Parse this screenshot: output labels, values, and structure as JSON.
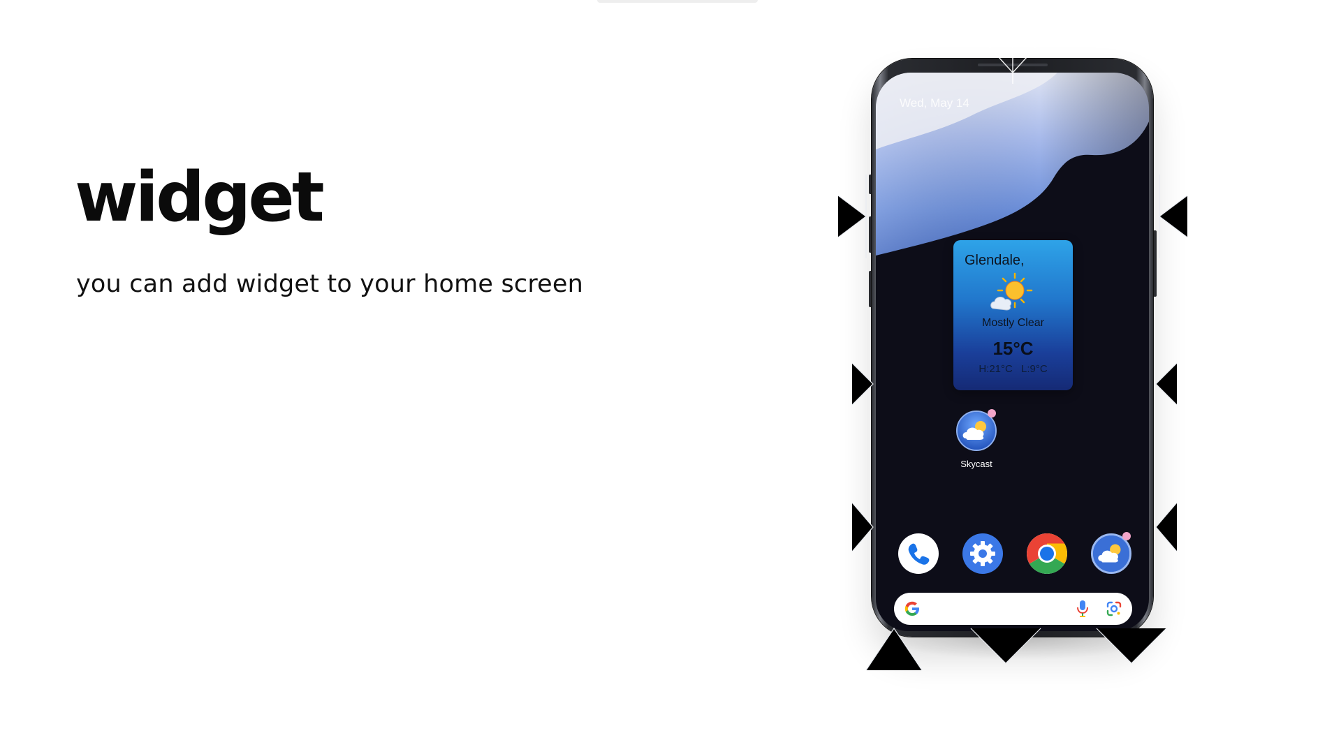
{
  "hero": {
    "title": "widget",
    "subtitle": "you can add widget to your home screen"
  },
  "phone": {
    "status_date": "Wed, May 14",
    "widget": {
      "city": "Glendale,",
      "condition": "Mostly Clear",
      "temperature": "15°C",
      "high_low": "H:21°C L:9°C",
      "icon": "sun-behind-cloud-icon"
    },
    "home_app": {
      "label": "Skycast",
      "icon": "skycast-weather-icon"
    },
    "dock": [
      {
        "name": "phone",
        "icon": "phone-icon"
      },
      {
        "name": "settings",
        "icon": "settings-gear-icon"
      },
      {
        "name": "chrome",
        "icon": "chrome-icon"
      },
      {
        "name": "skycast",
        "icon": "skycast-weather-icon"
      }
    ],
    "search_bar": {
      "icons": [
        "google-g-icon",
        "microphone-icon",
        "google-lens-icon"
      ]
    }
  },
  "colors": {
    "widget_top": "#2ea3e8",
    "widget_bottom": "#152a75",
    "screen_background": "#0d0d18",
    "wallpaper_wave": "#7f9ee6"
  }
}
